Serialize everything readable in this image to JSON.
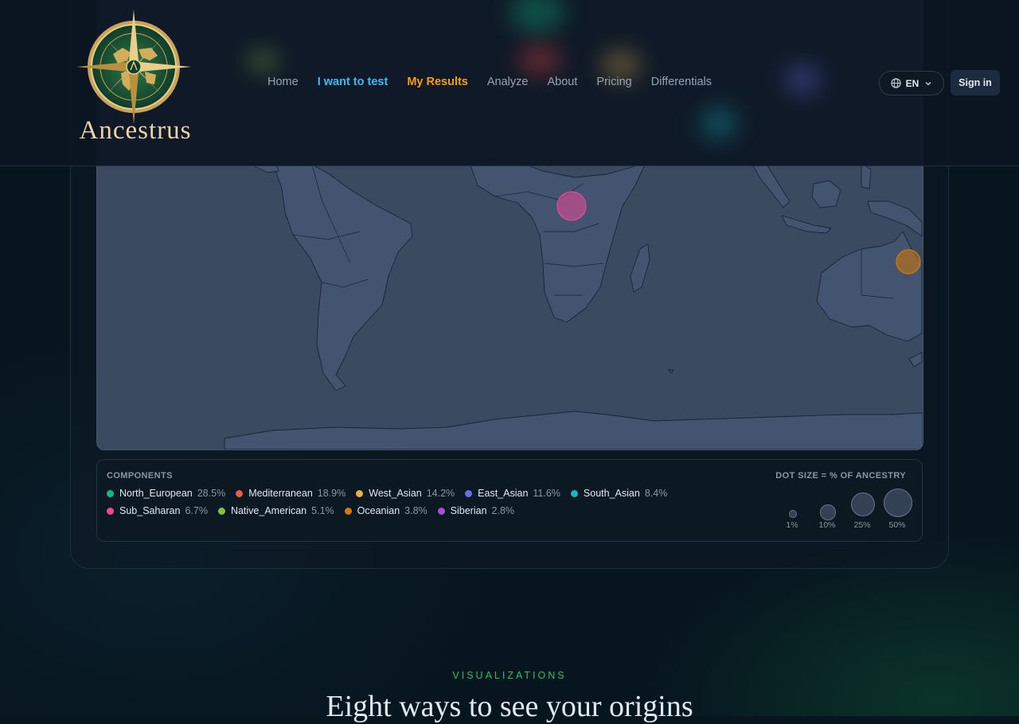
{
  "brand": {
    "name": "Ancestrus"
  },
  "nav": {
    "home": "Home",
    "test": "I want to test",
    "results": "My Results",
    "analyze": "Analyze",
    "about": "About",
    "pricing": "Pricing",
    "differentials": "Differentials"
  },
  "header": {
    "language": "EN",
    "signin": "Sign in"
  },
  "map": {
    "markers": [
      {
        "component": "Sub_Saharan",
        "color": "#ec4899"
      },
      {
        "component": "Oceanian",
        "color": "#d97706"
      }
    ]
  },
  "components": {
    "title": "COMPONENTS",
    "items": [
      {
        "name": "North_European",
        "pct": "28.5%",
        "color": "#10b981"
      },
      {
        "name": "Mediterranean",
        "pct": "18.9%",
        "color": "#ef5a4a"
      },
      {
        "name": "West_Asian",
        "pct": "14.2%",
        "color": "#e5b04a"
      },
      {
        "name": "East_Asian",
        "pct": "11.6%",
        "color": "#6c6fe8"
      },
      {
        "name": "South_Asian",
        "pct": "8.4%",
        "color": "#14b8c4"
      },
      {
        "name": "Sub_Saharan",
        "pct": "6.7%",
        "color": "#ec4899"
      },
      {
        "name": "Native_American",
        "pct": "5.1%",
        "color": "#84c043"
      },
      {
        "name": "Oceanian",
        "pct": "3.8%",
        "color": "#d97706"
      },
      {
        "name": "Siberian",
        "pct": "2.8%",
        "color": "#a94fd0"
      }
    ]
  },
  "dot_size": {
    "title": "DOT SIZE = % OF ANCESTRY",
    "scale": [
      "1%",
      "10%",
      "25%",
      "50%"
    ]
  },
  "section": {
    "eyebrow": "VISUALIZATIONS",
    "headline": "Eight ways to see your origins"
  }
}
